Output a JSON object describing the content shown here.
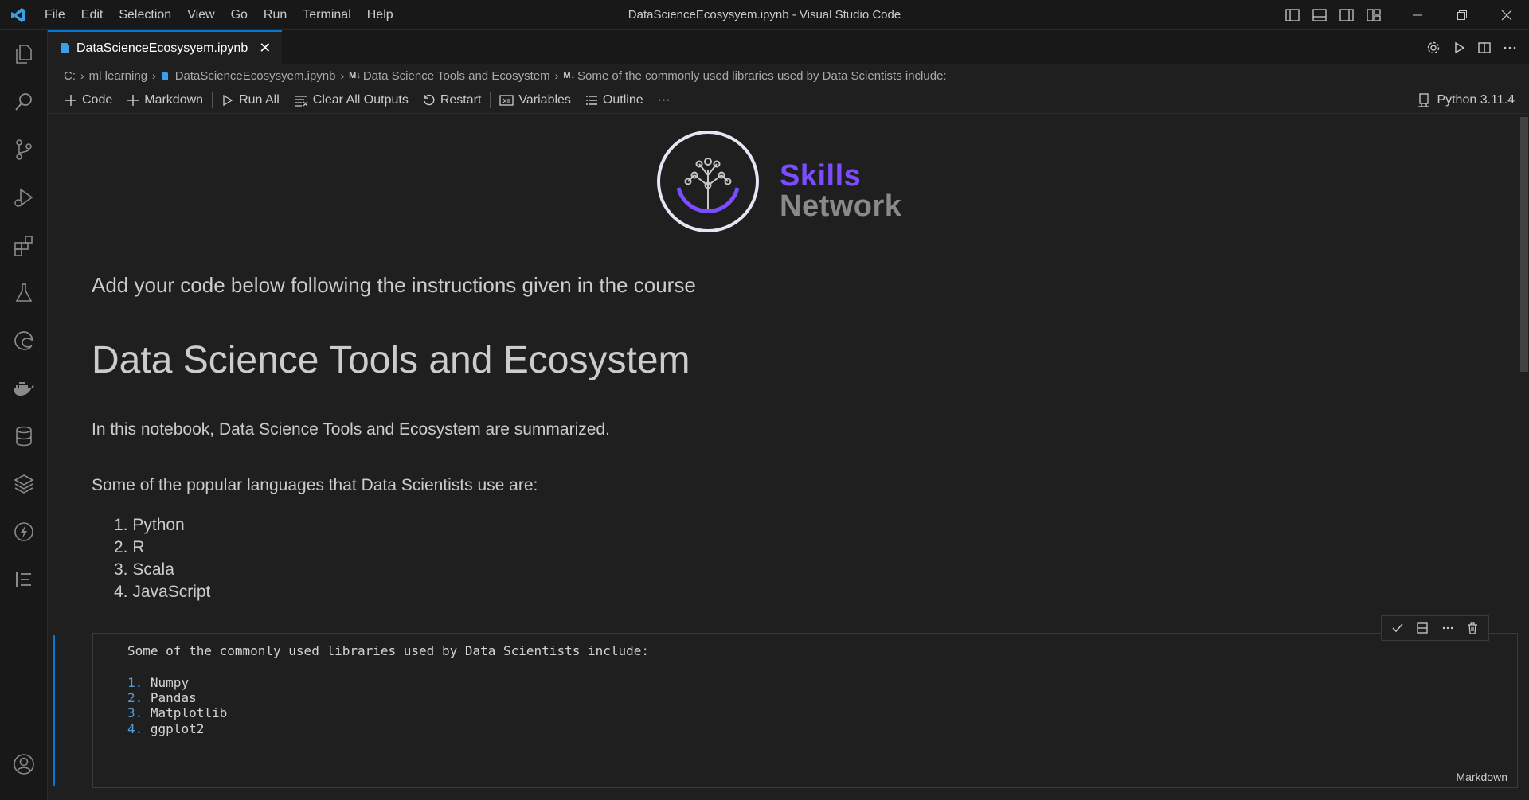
{
  "window": {
    "title": "DataScienceEcosysyem.ipynb - Visual Studio Code",
    "menu": [
      "File",
      "Edit",
      "Selection",
      "View",
      "Go",
      "Run",
      "Terminal",
      "Help"
    ]
  },
  "tab": {
    "label": "DataScienceEcosysyem.ipynb",
    "close": "✕"
  },
  "breadcrumb": {
    "drive": "C:",
    "folder": "ml learning",
    "file": "DataScienceEcosysyem.ipynb",
    "md_badge": "M↓",
    "section": "Data Science Tools and Ecosystem",
    "subsection": "Some of the commonly used libraries used by Data Scientists include:"
  },
  "toolbar": {
    "code": "Code",
    "markdown": "Markdown",
    "run_all": "Run All",
    "clear_outputs": "Clear All Outputs",
    "restart": "Restart",
    "variables": "Variables",
    "outline": "Outline",
    "more": "···",
    "kernel": "Python 3.11.4"
  },
  "logo": {
    "line1": "Skills",
    "line2": "Network"
  },
  "content": {
    "instruction": "Add your code below following the instructions given in the course",
    "heading": "Data Science Tools and Ecosystem",
    "intro": "In this notebook, Data Science Tools and Ecosystem are summarized.",
    "languages_intro": "Some of the popular languages that Data Scientists use are:",
    "languages": [
      "1. Python",
      "2. R",
      "3. Scala",
      "4. JavaScript"
    ]
  },
  "cell": {
    "line1": "Some of the commonly used libraries used by Data Scientists include:",
    "items": [
      {
        "num": "1.",
        "text": "Numpy"
      },
      {
        "num": "2.",
        "text": "Pandas"
      },
      {
        "num": "3.",
        "text": "Matplotlib"
      },
      {
        "num": "4.",
        "text": "ggplot2"
      }
    ],
    "language": "Markdown"
  },
  "colors": {
    "accent": "#0078d4",
    "logo_purple": "#7c4dff",
    "editor_bg": "#1f1f1f"
  }
}
